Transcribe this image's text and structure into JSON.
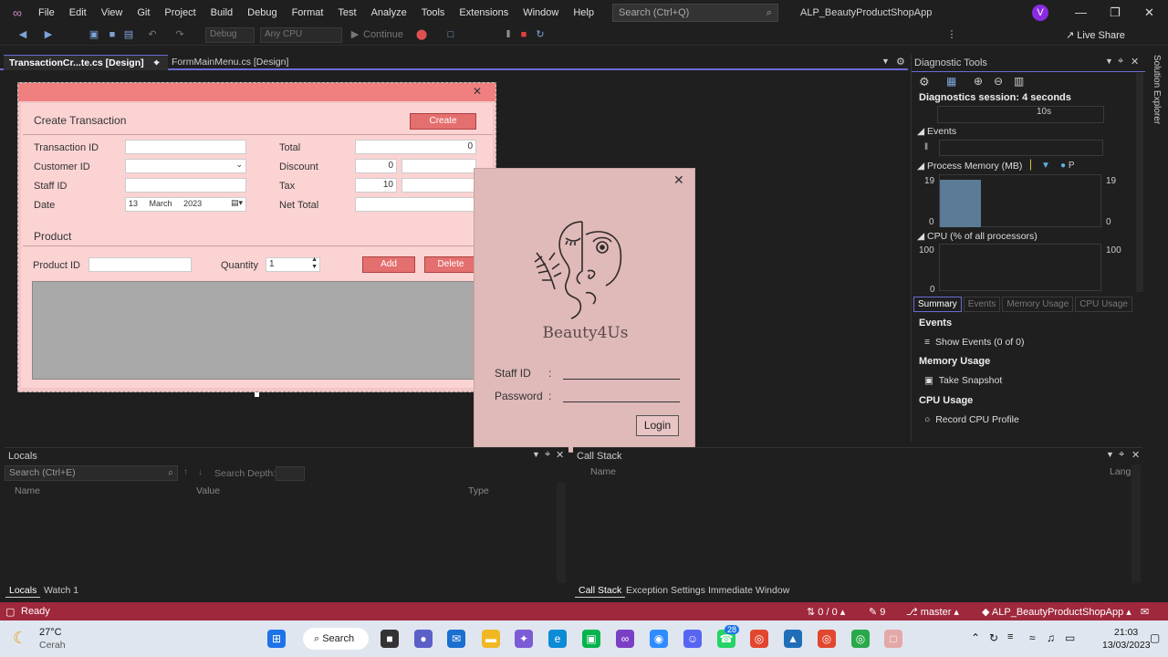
{
  "menubar": {
    "items": [
      "File",
      "Edit",
      "View",
      "Git",
      "Project",
      "Build",
      "Debug",
      "Format",
      "Test",
      "Analyze",
      "Tools",
      "Extensions",
      "Window",
      "Help"
    ],
    "search_placeholder": "Search (Ctrl+Q)",
    "app_title": "ALP_BeautyProductShopApp",
    "avatar_letter": "V"
  },
  "toolbar": {
    "config": "Debug",
    "platform": "Any CPU",
    "continue_label": "Continue",
    "live_share": "Live Share"
  },
  "doctabs": [
    {
      "label": "TransactionCr...te.cs [Design]",
      "active": true
    },
    {
      "label": "FormMainMenu.cs [Design]",
      "active": false
    }
  ],
  "form_transaction": {
    "section_title": "Create Transaction",
    "create_button": "Create",
    "labels": {
      "transaction_id": "Transaction ID",
      "customer_id": "Customer ID",
      "staff_id": "Staff ID",
      "date": "Date",
      "total": "Total",
      "discount": "Discount",
      "tax": "Tax",
      "net_total": "Net Total",
      "product": "Product",
      "product_id": "Product ID",
      "quantity": "Quantity"
    },
    "values": {
      "total": "0",
      "discount": "0",
      "tax": "10",
      "date_day": "13",
      "date_month": "March",
      "date_year": "2023",
      "quantity": "1"
    },
    "add_button": "Add",
    "delete_button": "Delete"
  },
  "login_form": {
    "brand": "Beauty4Us",
    "staff_id_label": "Staff ID",
    "password_label": "Password",
    "colon": ":",
    "login_button": "Login"
  },
  "diagnostics": {
    "title": "Diagnostic Tools",
    "session": "Diagnostics session: 4 seconds",
    "timeline_label": "10s",
    "events_label": "Events",
    "memory_label": "Process Memory (MB)",
    "memory_legend_p": "P",
    "memory_max": "19",
    "memory_min": "0",
    "cpu_label": "CPU (% of all processors)",
    "cpu_max": "100",
    "cpu_min": "0",
    "tabs": [
      "Summary",
      "Events",
      "Memory Usage",
      "CPU Usage"
    ],
    "summary": {
      "events_heading": "Events",
      "show_events": "Show Events (0 of 0)",
      "memory_heading": "Memory Usage",
      "take_snapshot": "Take Snapshot",
      "cpu_heading": "CPU Usage",
      "record_cpu": "Record CPU Profile"
    }
  },
  "solution_explorer_tab": "Solution Explorer",
  "locals": {
    "title": "Locals",
    "search_placeholder": "Search (Ctrl+E)",
    "search_depth": "Search Depth:",
    "columns": [
      "Name",
      "Value",
      "Type"
    ],
    "tabs": [
      "Locals",
      "Watch 1"
    ]
  },
  "callstack": {
    "title": "Call Stack",
    "columns": [
      "Name",
      "Lang"
    ],
    "tabs": [
      "Call Stack",
      "Exception Settings",
      "Immediate Window"
    ]
  },
  "statusbar": {
    "status": "Ready",
    "errors": "0 / 0",
    "edits": "9",
    "branch": "master",
    "project": "ALP_BeautyProductShopApp"
  },
  "taskbar": {
    "weather_temp": "27°C",
    "weather_desc": "Cerah",
    "search_label": "Search",
    "badge_count": "28",
    "time": "21:03",
    "date": "13/03/2023"
  }
}
